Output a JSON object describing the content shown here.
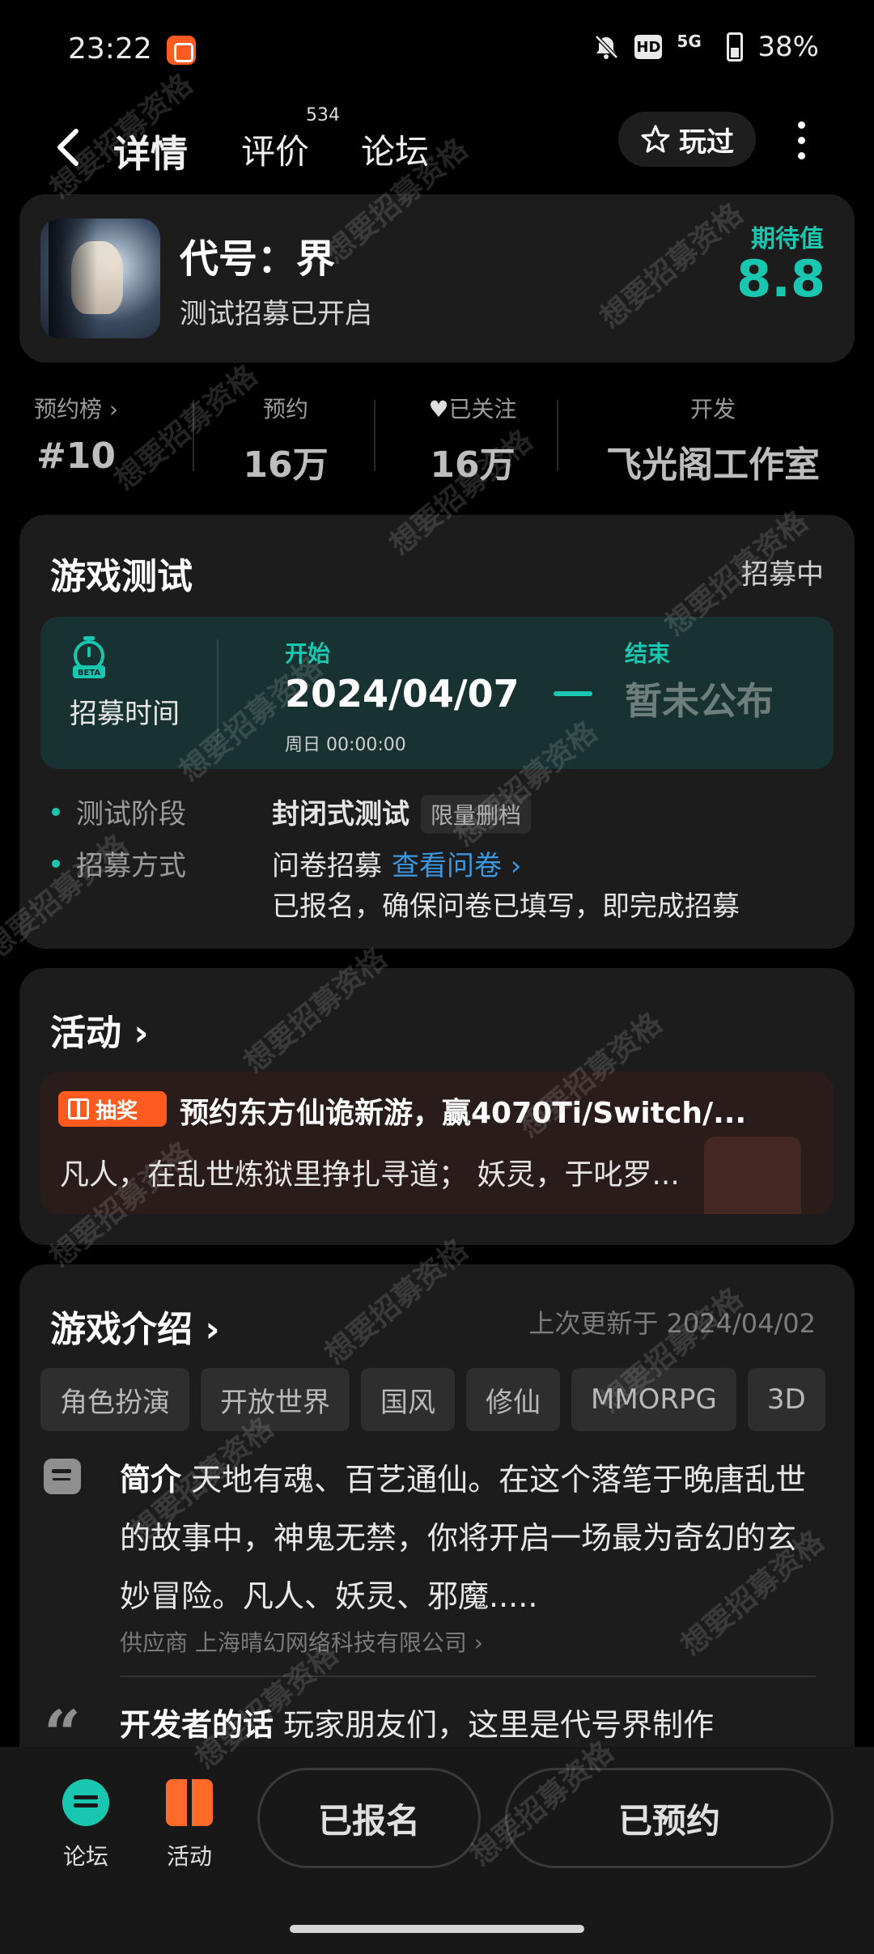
{
  "status_bar": {
    "time": "23:22",
    "network": "5G",
    "battery": "38%",
    "icons": [
      "mute-icon",
      "hd-icon",
      "signal-icon",
      "battery-icon"
    ]
  },
  "nav": {
    "tabs": [
      {
        "label": "详情",
        "active": true
      },
      {
        "label": "评价",
        "badge": "534"
      },
      {
        "label": "论坛"
      }
    ],
    "played_button": "玩过"
  },
  "game": {
    "title": "代号：界",
    "subtitle": "测试招募已开启",
    "expect_label": "期待值",
    "expect_value": "8.8"
  },
  "stats": [
    {
      "label": "预约榜 ›",
      "value": "#10"
    },
    {
      "label": "预约",
      "value": "16万"
    },
    {
      "label": "已关注",
      "value": "16万"
    },
    {
      "label": "开发",
      "value": "飞光阁工作室"
    }
  ],
  "test": {
    "title": "游戏测试",
    "status": "招募中",
    "recruit_label": "招募时间",
    "beta_text": "BETA",
    "start_label": "开始",
    "start_date": "2024/04/07",
    "start_time": "周日  00:00:00",
    "end_label": "结束",
    "end_value": "暂未公布",
    "stage_label": "测试阶段",
    "stage_value": "封闭式测试",
    "stage_tag": "限量删档",
    "method_label": "招募方式",
    "method_value": "问卷招募",
    "method_link": "查看问卷 ›",
    "method_note": "已报名，确保问卷已填写，即完成招募"
  },
  "activity": {
    "title": "活动 ›",
    "badge": "抽奖",
    "headline": "预约东方仙诡新游，赢4070Ti/Switch/...",
    "desc": "凡人，在乱世炼狱里挣扎寻道；  妖灵，于叱罗..."
  },
  "intro": {
    "title": "游戏介绍 ›",
    "updated": "上次更新于 2024/04/02",
    "tags": [
      "角色扮演",
      "开放世界",
      "国风",
      "修仙",
      "MMORPG",
      "3D"
    ],
    "summary_label": "简介",
    "summary": "天地有魂、百艺通仙。在这个落笔于晚唐乱世的故事中，神鬼无禁，你将开启一场最为奇幻的玄妙冒险。凡人、妖灵、邪魔.....",
    "supplier": "供应商 上海晴幻网络科技有限公司 ›",
    "dev_label": "开发者的话",
    "dev_words": "玩家朋友们，这里是代号界制作"
  },
  "bottom_bar": {
    "forum": "论坛",
    "activity": "活动",
    "signed_up": "已报名",
    "reserved": "已预约"
  },
  "watermark": "想要招募资格",
  "colors": {
    "accent": "#19c7b1",
    "orange": "#ff5a1f",
    "link": "#3b98e0",
    "card": "#1c1c1c"
  }
}
